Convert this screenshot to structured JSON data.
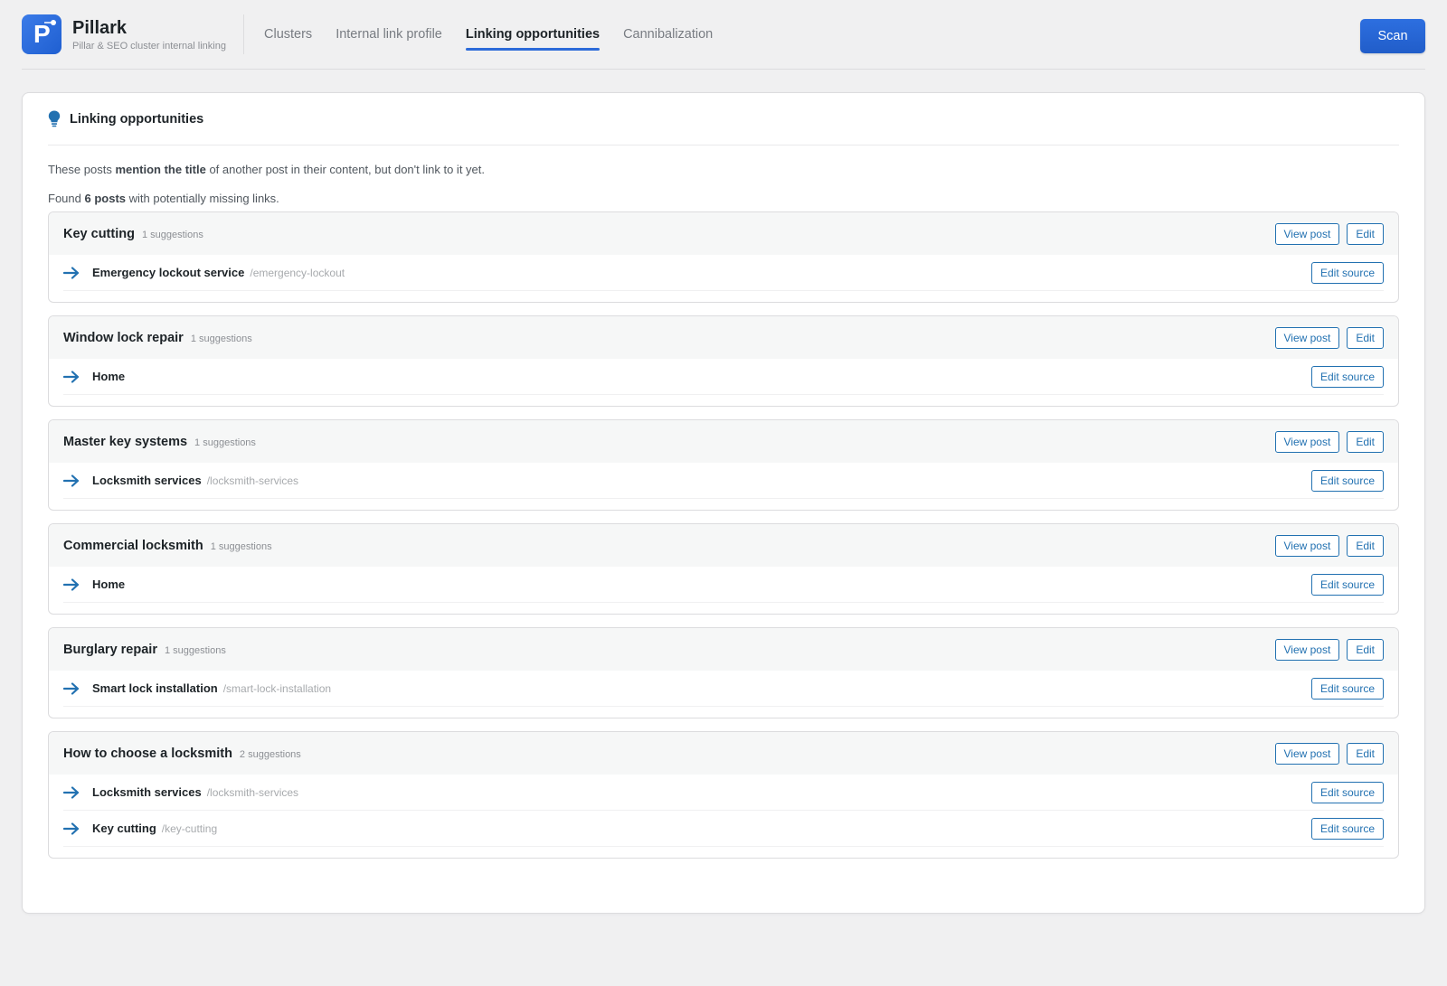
{
  "header": {
    "brand_name": "Pillark",
    "brand_tagline": "Pillar & SEO cluster internal linking",
    "tabs": [
      {
        "label": "Clusters",
        "active": false
      },
      {
        "label": "Internal link profile",
        "active": false
      },
      {
        "label": "Linking opportunities",
        "active": true
      },
      {
        "label": "Cannibalization",
        "active": false
      }
    ],
    "scan_label": "Scan"
  },
  "panel": {
    "title": "Linking opportunities",
    "intro_prefix": "These posts ",
    "intro_bold": "mention the title",
    "intro_suffix": " of another post in their content, but don't link to it yet.",
    "found_prefix": "Found ",
    "found_bold": "6 posts",
    "found_suffix": " with potentially missing links.",
    "view_post_label": "View post",
    "edit_label": "Edit",
    "edit_source_label": "Edit source"
  },
  "groups": [
    {
      "title": "Key cutting",
      "count": "1 suggestions",
      "items": [
        {
          "title": "Emergency lockout service",
          "slug": "/emergency-lockout"
        }
      ]
    },
    {
      "title": "Window lock repair",
      "count": "1 suggestions",
      "items": [
        {
          "title": "Home",
          "slug": ""
        }
      ]
    },
    {
      "title": "Master key systems",
      "count": "1 suggestions",
      "items": [
        {
          "title": "Locksmith services",
          "slug": "/locksmith-services"
        }
      ]
    },
    {
      "title": "Commercial locksmith",
      "count": "1 suggestions",
      "items": [
        {
          "title": "Home",
          "slug": ""
        }
      ]
    },
    {
      "title": "Burglary repair",
      "count": "1 suggestions",
      "items": [
        {
          "title": "Smart lock installation",
          "slug": "/smart-lock-installation"
        }
      ]
    },
    {
      "title": "How to choose a locksmith",
      "count": "2 suggestions",
      "items": [
        {
          "title": "Locksmith services",
          "slug": "/locksmith-services"
        },
        {
          "title": "Key cutting",
          "slug": "/key-cutting"
        }
      ]
    }
  ],
  "colors": {
    "accent": "#2c6bd9",
    "link": "#2271b1",
    "arrow": "#2271b1"
  }
}
